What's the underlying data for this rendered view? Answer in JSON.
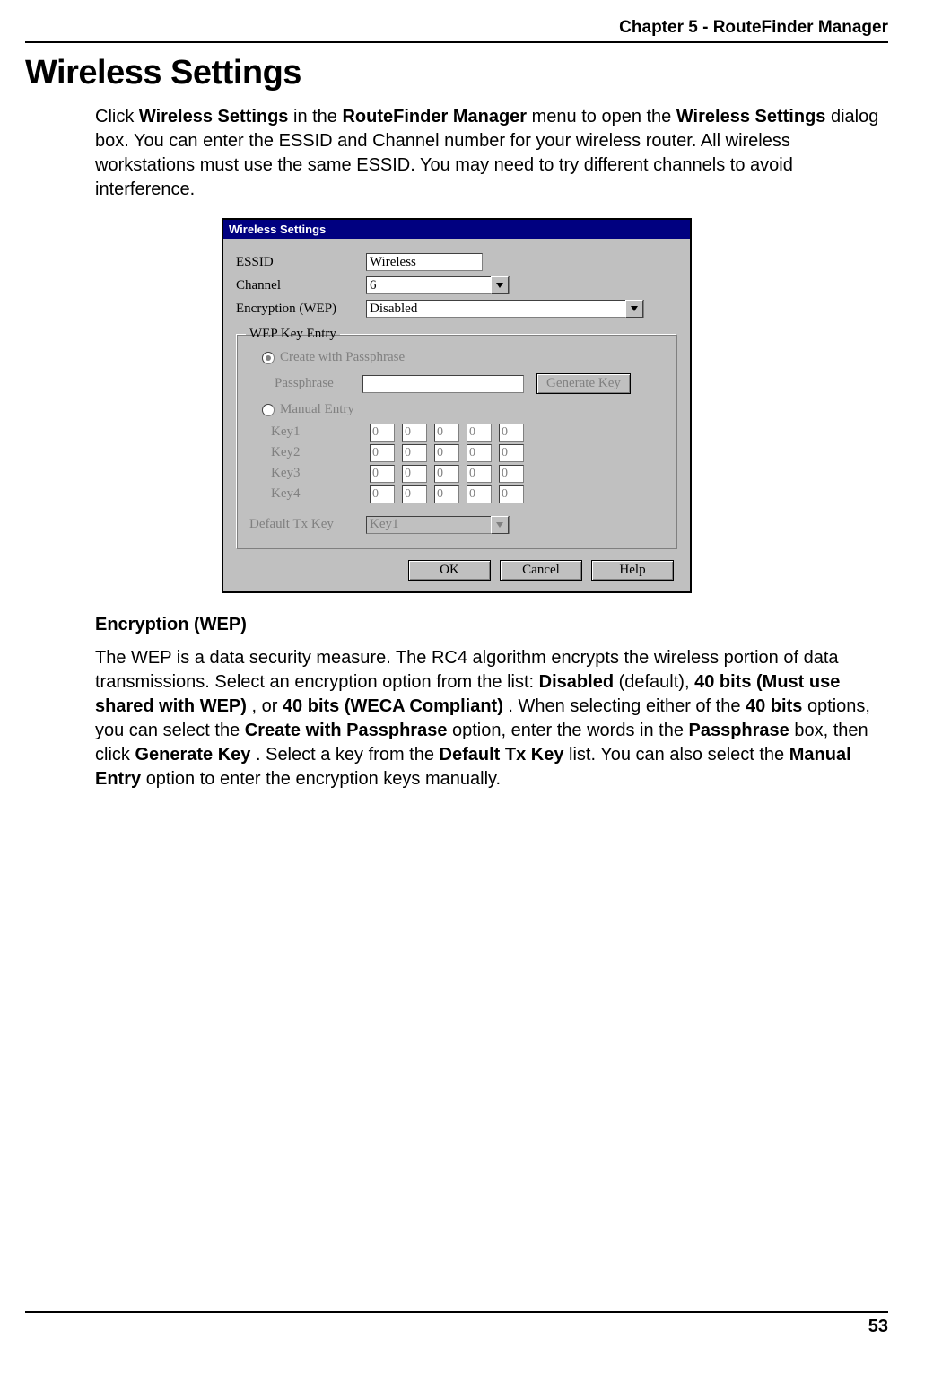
{
  "header": {
    "chapter": "Chapter 5 - RouteFinder Manager"
  },
  "title": "Wireless Settings",
  "intro": {
    "pre": "Click ",
    "b1": "Wireless Settings",
    "mid1": " in the ",
    "b2": "RouteFinder Manager",
    "mid2": " menu to open the ",
    "b3": "Wireless Settings",
    "post": " dialog box.  You can enter the ESSID and Channel number for your wireless router.  All wireless workstations must use the same ESSID.  You may need to try different channels to avoid interference."
  },
  "dialog": {
    "title": "Wireless Settings",
    "labels": {
      "essid": "ESSID",
      "channel": "Channel",
      "encryption": "Encryption (WEP)",
      "group": "WEP Key Entry",
      "create_pass": "Create with Passphrase",
      "passphrase": "Passphrase",
      "manual": "Manual Entry",
      "key1": "Key1",
      "key2": "Key2",
      "key3": "Key3",
      "key4": "Key4",
      "default_tx": "Default Tx Key"
    },
    "values": {
      "essid": "Wireless",
      "channel": "6",
      "encryption": "Disabled",
      "passphrase": "",
      "keycell": "0",
      "default_tx": "Key1"
    },
    "buttons": {
      "generate": "Generate Key",
      "ok": "OK",
      "cancel": "Cancel",
      "help": "Help"
    }
  },
  "section2": {
    "heading": "Encryption (WEP)",
    "p_pre": "The WEP is a data security measure.  The RC4 algorithm encrypts the wireless portion of data transmissions.  Select an encryption option from the list: ",
    "b1": "Disabled",
    "mid1": " (default), ",
    "b2": "40 bits (Must use shared with WEP)",
    "mid2": ", or ",
    "b3": "40 bits (WECA Compliant)",
    "mid3": ".  When selecting either of the ",
    "b4": "40 bits",
    "mid4": " options, you can select the ",
    "b5": "Create with Passphrase",
    "mid5": " option, enter the words in the ",
    "b6": "Passphrase",
    "mid6": " box, then click ",
    "b7": "Generate Key",
    "mid7": ".  Select a key from the ",
    "b8": "Default Tx Key",
    "mid8": " list.  You can also select the ",
    "b9": "Manual Entry",
    "post": " option to enter the encryption keys manually."
  },
  "footer": {
    "page": "53"
  }
}
